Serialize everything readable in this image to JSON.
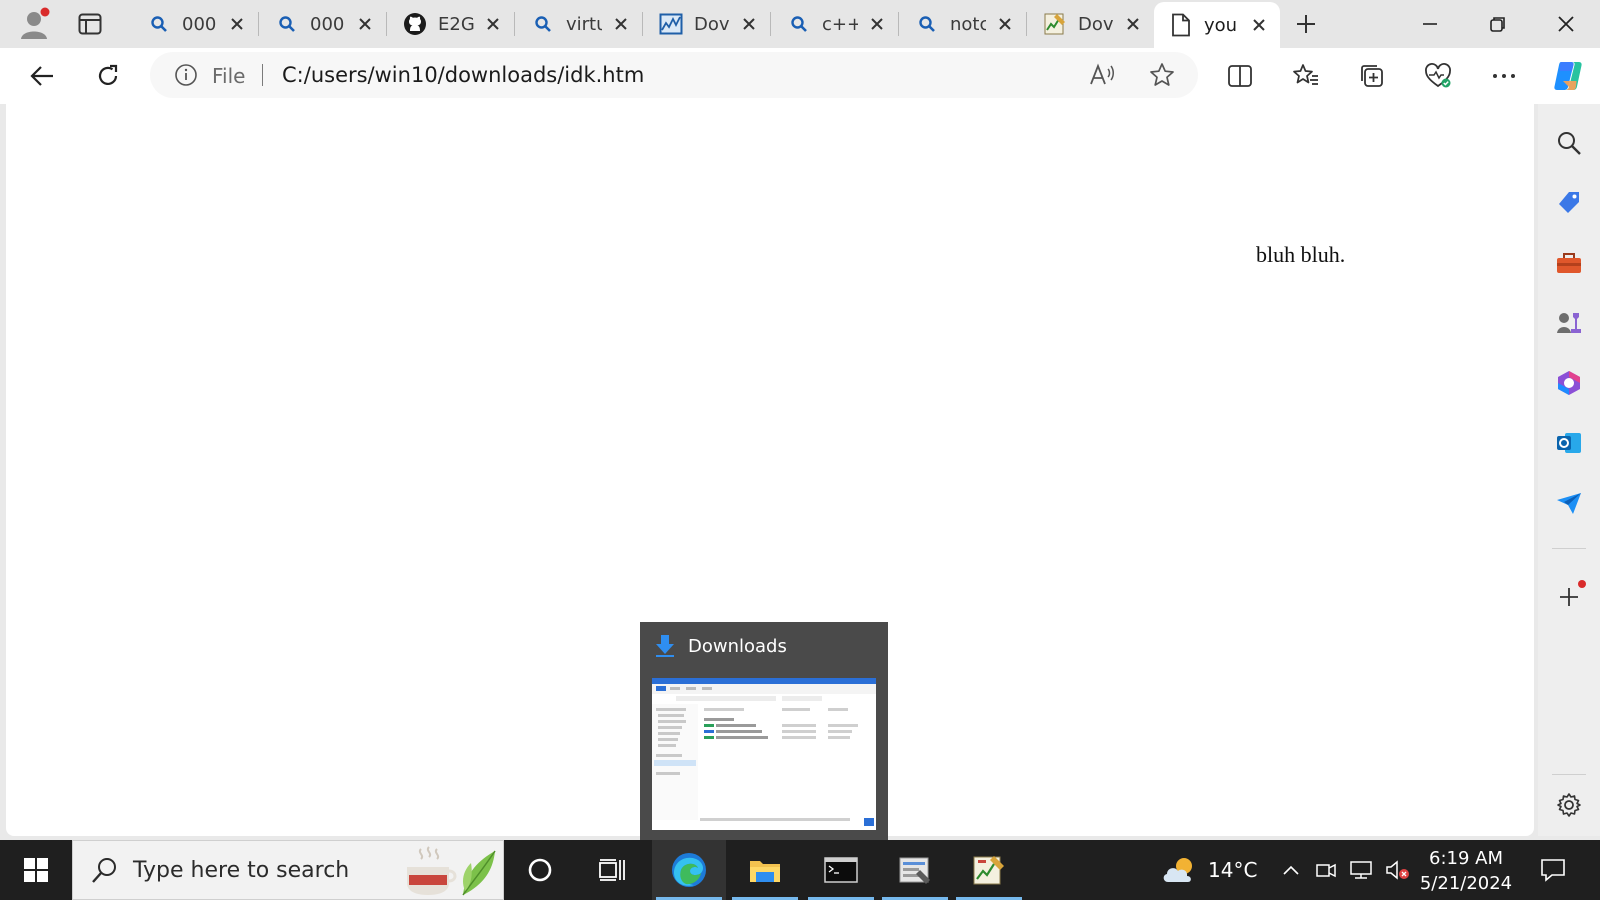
{
  "browser": {
    "tabs": [
      {
        "title": "000",
        "favicon": "search-icon"
      },
      {
        "title": "000",
        "favicon": "search-icon"
      },
      {
        "title": "E2G",
        "favicon": "github-icon"
      },
      {
        "title": "virtu",
        "favicon": "search-icon"
      },
      {
        "title": "Dov",
        "favicon": "chart-icon"
      },
      {
        "title": "c++",
        "favicon": "search-icon"
      },
      {
        "title": "notc",
        "favicon": "search-icon"
      },
      {
        "title": "Dov",
        "favicon": "spreadsheet-icon"
      },
      {
        "title": "you",
        "favicon": "document-icon",
        "active": true
      }
    ],
    "address": {
      "scheme_label": "File",
      "url": "C:/users/win10/downloads/idk.htm"
    },
    "accent_color": "#0078d4"
  },
  "page": {
    "text": "bluh bluh."
  },
  "taskbar_preview": {
    "title": "Downloads"
  },
  "taskbar": {
    "search_placeholder": "Type here to search",
    "weather_temp": "14°C",
    "clock_time": "6:19 AM",
    "clock_date": "5/21/2024"
  }
}
